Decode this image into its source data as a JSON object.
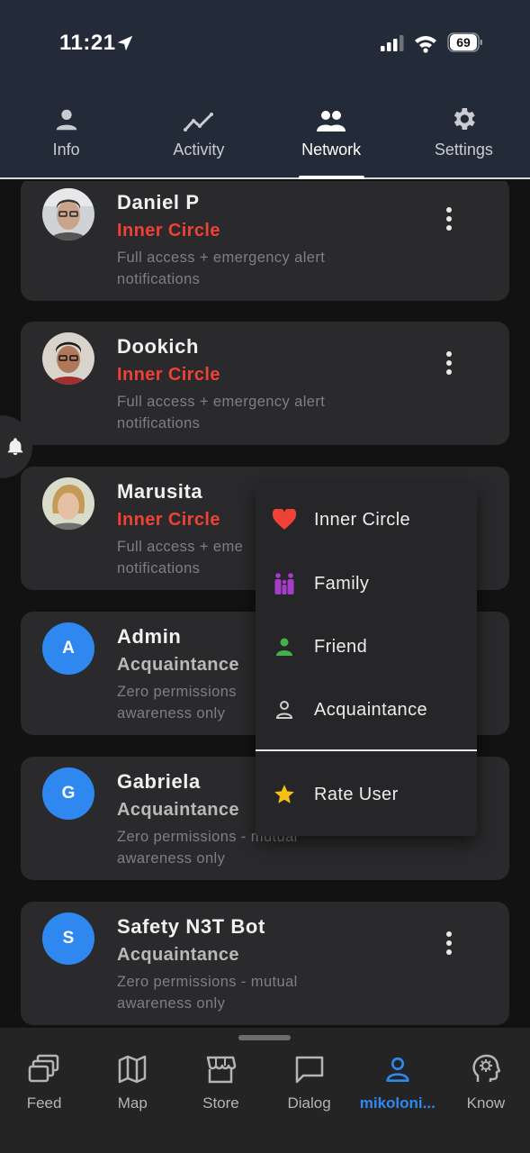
{
  "status_bar": {
    "time": "11:21",
    "battery": "69"
  },
  "tabs": [
    {
      "label": "Info",
      "icon": "person-icon"
    },
    {
      "label": "Activity",
      "icon": "activity-icon"
    },
    {
      "label": "Network",
      "icon": "people-icon",
      "active": true
    },
    {
      "label": "Settings",
      "icon": "gear-icon"
    }
  ],
  "contacts": [
    {
      "name": "Daniel P",
      "role": "Inner Circle",
      "desc": "Full access + emergency alert notifications",
      "avatar": "photo"
    },
    {
      "name": "Dookich",
      "role": "Inner Circle",
      "desc": "Full access + emergency alert notifications",
      "avatar": "photo"
    },
    {
      "name": "Marusita",
      "role": "Inner Circle",
      "desc": "Full access + eme notifications",
      "avatar": "photo"
    },
    {
      "name": "Admin",
      "role": "Acquaintance",
      "desc": "Zero permissions awareness only",
      "initial": "A"
    },
    {
      "name": "Gabriela",
      "role": "Acquaintance",
      "desc": "Zero permissions - mutual awareness only",
      "initial": "G"
    },
    {
      "name": "Safety N3T Bot",
      "role": "Acquaintance",
      "desc": "Zero permissions - mutual awareness only",
      "initial": "S"
    }
  ],
  "menu": {
    "items": [
      {
        "label": "Inner Circle",
        "icon": "heart-icon",
        "color": "#ef4136"
      },
      {
        "label": "Family",
        "icon": "family-icon",
        "color": "#a43ec6"
      },
      {
        "label": "Friend",
        "icon": "person-icon",
        "color": "#43b04a"
      },
      {
        "label": "Acquaintance",
        "icon": "person-outline-icon",
        "color": "#cfcfcf"
      }
    ],
    "rate_label": "Rate User",
    "rate_icon": "star-icon",
    "rate_color": "#f5c211"
  },
  "bottom_nav": [
    {
      "label": "Feed",
      "icon": "feed-icon"
    },
    {
      "label": "Map",
      "icon": "map-icon"
    },
    {
      "label": "Store",
      "icon": "store-icon"
    },
    {
      "label": "Dialog",
      "icon": "chat-icon"
    },
    {
      "label": "mikoloni...",
      "icon": "person-outline-icon",
      "active": true
    },
    {
      "label": "Know",
      "icon": "brain-icon"
    }
  ],
  "colors": {
    "header_bg": "#242b38",
    "card_bg": "#2a2a2c",
    "accent": "#2f88f0",
    "inner_circle": "#ef4136"
  }
}
